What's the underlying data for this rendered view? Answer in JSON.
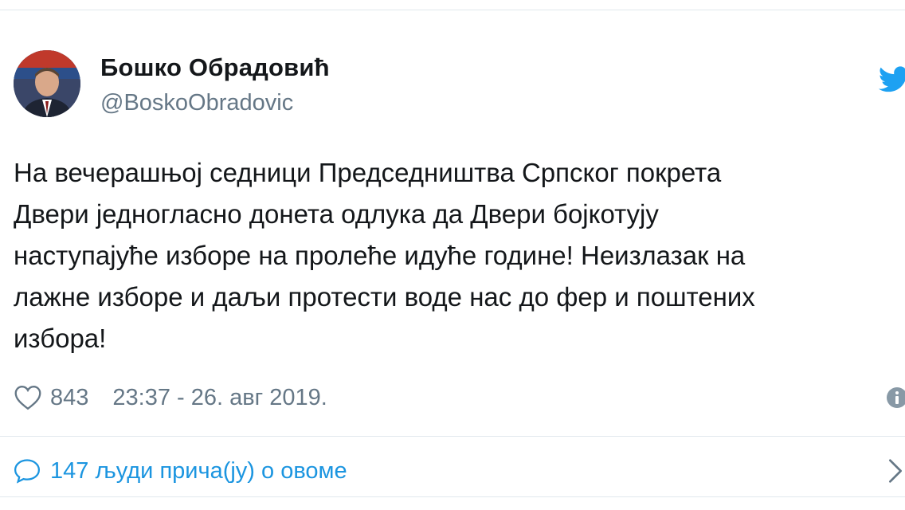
{
  "author": {
    "display_name": "Бошко Обрадовић",
    "handle": "@BoskoObradovic",
    "avatar_icon": "profile-photo"
  },
  "tweet": {
    "lines": [
      "На вечерашњој седници Председништва Српског покрета",
      "Двери једногласно донета одлука да Двери бојкотују",
      "наступајуће изборе на пролеће идуће године! Неизлазак на",
      "лажне изборе и даљи протести воде нас до фер и поштених",
      "избора!"
    ]
  },
  "meta": {
    "like_count": "843",
    "timestamp": "23:37 - 26. авг 2019.",
    "like_icon": "heart-outline-icon",
    "info_icon": "info-icon"
  },
  "conversation": {
    "label": "147 људи прича(ју) о овоме",
    "icon": "speech-bubble-icon",
    "chevron": "chevron-right-icon"
  },
  "colors": {
    "text": "#14171a",
    "secondary": "#657786",
    "link": "#1b95e0",
    "twitter_blue": "#1da1f2",
    "border": "#e1e8ed"
  }
}
